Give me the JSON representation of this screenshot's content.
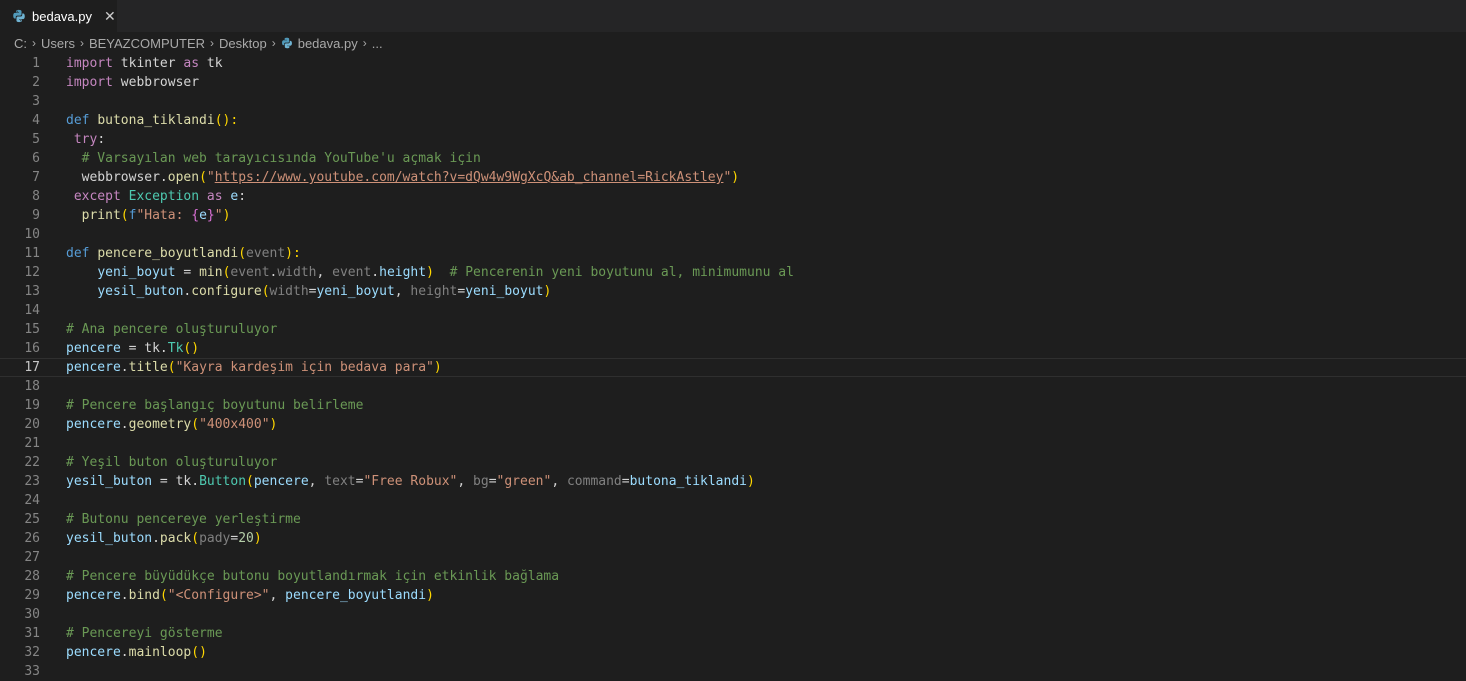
{
  "tab": {
    "filename": "bedava.py",
    "close_glyph": "✕"
  },
  "breadcrumb": {
    "parts": [
      "C:",
      "Users",
      "BEYAZCOMPUTER",
      "Desktop",
      "bedava.py",
      "..."
    ]
  },
  "code": {
    "active_line": 17,
    "lines": [
      [
        [
          "kw2",
          "import"
        ],
        [
          "pl",
          " tkinter "
        ],
        [
          "kw2",
          "as"
        ],
        [
          "pl",
          " tk"
        ]
      ],
      [
        [
          "kw2",
          "import"
        ],
        [
          "pl",
          " webbrowser"
        ]
      ],
      [],
      [
        [
          "kw",
          "def"
        ],
        [
          "pl",
          " "
        ],
        [
          "fn",
          "butona_tiklandi"
        ],
        [
          "br1",
          "():"
        ]
      ],
      [
        [
          "pl",
          " "
        ],
        [
          "kw2",
          "try"
        ],
        [
          "pl",
          ":"
        ]
      ],
      [
        [
          "pl",
          "  "
        ],
        [
          "cmt",
          "# Varsayılan web tarayıcısında YouTube'u açmak için"
        ]
      ],
      [
        [
          "pl",
          "  webbrowser."
        ],
        [
          "fn",
          "open"
        ],
        [
          "br1",
          "("
        ],
        [
          "str",
          "\""
        ],
        [
          "url",
          "https://www.youtube.com/watch?v=dQw4w9WgXcQ&ab_channel=RickAstley"
        ],
        [
          "str",
          "\""
        ],
        [
          "br1",
          ")"
        ]
      ],
      [
        [
          "pl",
          " "
        ],
        [
          "kw2",
          "except"
        ],
        [
          "pl",
          " "
        ],
        [
          "cls",
          "Exception"
        ],
        [
          "pl",
          " "
        ],
        [
          "kw2",
          "as"
        ],
        [
          "pl",
          " "
        ],
        [
          "var",
          "e"
        ],
        [
          "pl",
          ":"
        ]
      ],
      [
        [
          "pl",
          "  "
        ],
        [
          "fn",
          "print"
        ],
        [
          "br1",
          "("
        ],
        [
          "kw",
          "f"
        ],
        [
          "str",
          "\"Hata: "
        ],
        [
          "br2",
          "{"
        ],
        [
          "var",
          "e"
        ],
        [
          "br2",
          "}"
        ],
        [
          "str",
          "\""
        ],
        [
          "br1",
          ")"
        ]
      ],
      [],
      [
        [
          "kw",
          "def"
        ],
        [
          "pl",
          " "
        ],
        [
          "fn",
          "pencere_boyutlandi"
        ],
        [
          "br1",
          "("
        ],
        [
          "par",
          "event"
        ],
        [
          "br1",
          "):"
        ]
      ],
      [
        [
          "pl",
          "    "
        ],
        [
          "var",
          "yeni_boyut"
        ],
        [
          "pl",
          " = "
        ],
        [
          "fn",
          "min"
        ],
        [
          "br1",
          "("
        ],
        [
          "par",
          "event"
        ],
        [
          "pl",
          "."
        ],
        [
          "par",
          "width"
        ],
        [
          "pl",
          ", "
        ],
        [
          "par",
          "event"
        ],
        [
          "pl",
          "."
        ],
        [
          "var",
          "height"
        ],
        [
          "br1",
          ")"
        ],
        [
          "pl",
          "  "
        ],
        [
          "cmt",
          "# Pencerenin yeni boyutunu al, minimumunu al"
        ]
      ],
      [
        [
          "pl",
          "    "
        ],
        [
          "var",
          "yesil_buton"
        ],
        [
          "pl",
          "."
        ],
        [
          "fn",
          "configure"
        ],
        [
          "br1",
          "("
        ],
        [
          "par",
          "width"
        ],
        [
          "pl",
          "="
        ],
        [
          "var",
          "yeni_boyut"
        ],
        [
          "pl",
          ", "
        ],
        [
          "par",
          "height"
        ],
        [
          "pl",
          "="
        ],
        [
          "var",
          "yeni_boyut"
        ],
        [
          "br1",
          ")"
        ]
      ],
      [],
      [
        [
          "cmt",
          "# Ana pencere oluşturuluyor"
        ]
      ],
      [
        [
          "var",
          "pencere"
        ],
        [
          "pl",
          " = tk."
        ],
        [
          "cls",
          "Tk"
        ],
        [
          "br1",
          "()"
        ]
      ],
      [
        [
          "var",
          "pencere"
        ],
        [
          "pl",
          "."
        ],
        [
          "fn",
          "title"
        ],
        [
          "br1",
          "("
        ],
        [
          "str",
          "\"Kayra kardeşim için bedava para\""
        ],
        [
          "br1",
          ")"
        ]
      ],
      [],
      [
        [
          "cmt",
          "# Pencere başlangıç boyutunu belirleme"
        ]
      ],
      [
        [
          "var",
          "pencere"
        ],
        [
          "pl",
          "."
        ],
        [
          "fn",
          "geometry"
        ],
        [
          "br1",
          "("
        ],
        [
          "str",
          "\"400x400\""
        ],
        [
          "br1",
          ")"
        ]
      ],
      [],
      [
        [
          "cmt",
          "# Yeşil buton oluşturuluyor"
        ]
      ],
      [
        [
          "var",
          "yesil_buton"
        ],
        [
          "pl",
          " = tk."
        ],
        [
          "cls",
          "Button"
        ],
        [
          "br1",
          "("
        ],
        [
          "var",
          "pencere"
        ],
        [
          "pl",
          ", "
        ],
        [
          "par",
          "text"
        ],
        [
          "pl",
          "="
        ],
        [
          "str",
          "\"Free Robux\""
        ],
        [
          "pl",
          ", "
        ],
        [
          "par",
          "bg"
        ],
        [
          "pl",
          "="
        ],
        [
          "str",
          "\"green\""
        ],
        [
          "pl",
          ", "
        ],
        [
          "par",
          "command"
        ],
        [
          "pl",
          "="
        ],
        [
          "var",
          "butona_tiklandi"
        ],
        [
          "br1",
          ")"
        ]
      ],
      [],
      [
        [
          "cmt",
          "# Butonu pencereye yerleştirme"
        ]
      ],
      [
        [
          "var",
          "yesil_buton"
        ],
        [
          "pl",
          "."
        ],
        [
          "fn",
          "pack"
        ],
        [
          "br1",
          "("
        ],
        [
          "par",
          "pady"
        ],
        [
          "pl",
          "="
        ],
        [
          "num",
          "20"
        ],
        [
          "br1",
          ")"
        ]
      ],
      [],
      [
        [
          "cmt",
          "# Pencere büyüdükçe butonu boyutlandırmak için etkinlik bağlama"
        ]
      ],
      [
        [
          "var",
          "pencere"
        ],
        [
          "pl",
          "."
        ],
        [
          "fn",
          "bind"
        ],
        [
          "br1",
          "("
        ],
        [
          "str",
          "\"<Configure>\""
        ],
        [
          "pl",
          ", "
        ],
        [
          "var",
          "pencere_boyutlandi"
        ],
        [
          "br1",
          ")"
        ]
      ],
      [],
      [
        [
          "cmt",
          "# Pencereyi gösterme"
        ]
      ],
      [
        [
          "var",
          "pencere"
        ],
        [
          "pl",
          "."
        ],
        [
          "fn",
          "mainloop"
        ],
        [
          "br1",
          "()"
        ]
      ],
      []
    ]
  }
}
